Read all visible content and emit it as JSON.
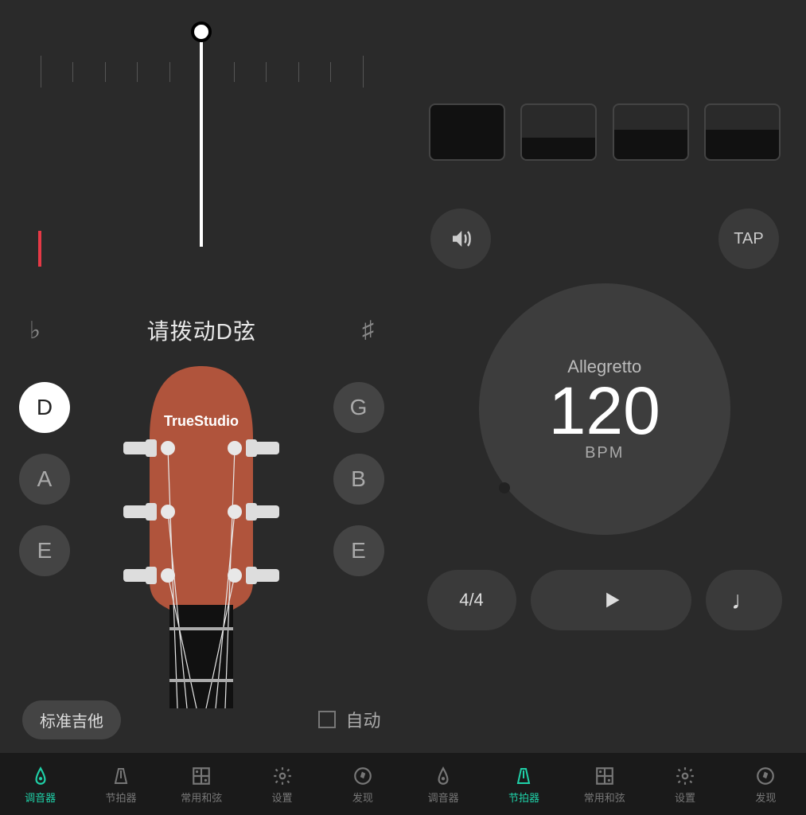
{
  "tuner": {
    "instruction": "请拨动D弦",
    "flat": "♭",
    "sharp": "♯",
    "brand": "TrueStudio",
    "strings_left": [
      "D",
      "A",
      "E"
    ],
    "strings_right": [
      "G",
      "B",
      "E"
    ],
    "active_string": "D",
    "preset_label": "标准吉他",
    "auto_label": "自动",
    "auto_checked": false
  },
  "metronome": {
    "beats": 4,
    "sound_button": "speaker",
    "tap_label": "TAP",
    "tempo_name": "Allegretto",
    "bpm": "120",
    "bpm_unit": "BPM",
    "time_signature": "4/4",
    "note_value": "♩"
  },
  "nav": {
    "items": [
      {
        "label": "调音器",
        "icon": "tuner"
      },
      {
        "label": "节拍器",
        "icon": "metronome"
      },
      {
        "label": "常用和弦",
        "icon": "chords"
      },
      {
        "label": "设置",
        "icon": "settings"
      },
      {
        "label": "发现",
        "icon": "discover"
      }
    ],
    "active_left": 0,
    "active_right": 1
  }
}
